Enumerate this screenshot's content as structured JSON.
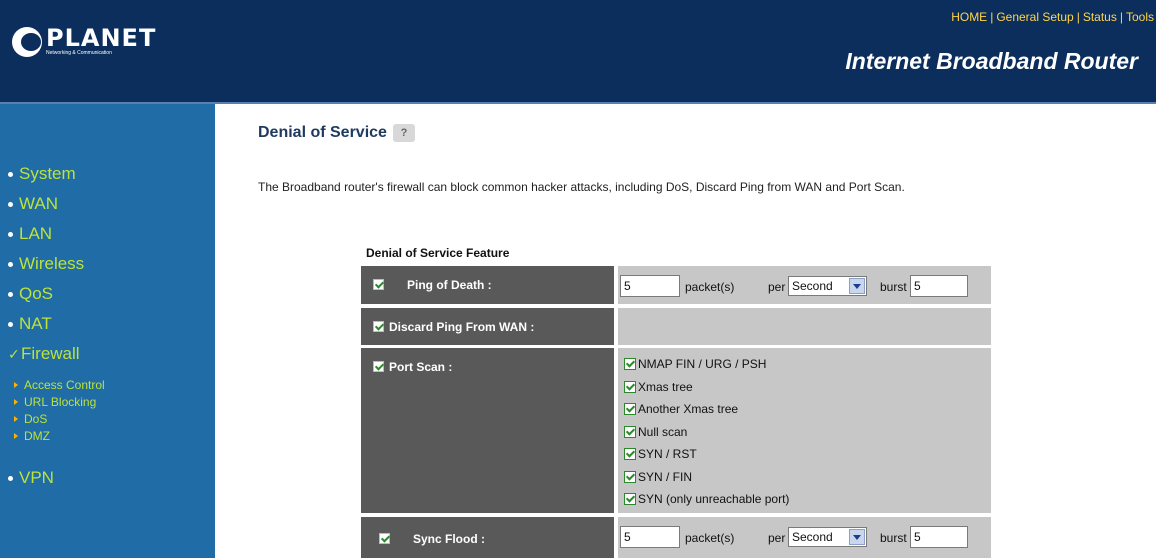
{
  "header": {
    "brand": "PLANET",
    "brand_sub": "Networking & Communication",
    "nav": [
      "HOME",
      "General Setup",
      "Status",
      "Tools"
    ],
    "nav_separator": "|",
    "product_title": "Internet Broadband Router"
  },
  "sidebar": {
    "items": [
      {
        "label": "System"
      },
      {
        "label": "WAN"
      },
      {
        "label": "LAN"
      },
      {
        "label": "Wireless"
      },
      {
        "label": "QoS"
      },
      {
        "label": "NAT"
      },
      {
        "label": "Firewall",
        "selected": true
      },
      {
        "label": "VPN"
      }
    ],
    "firewall_sub": [
      {
        "label": "Access Control"
      },
      {
        "label": "URL Blocking"
      },
      {
        "label": "DoS"
      },
      {
        "label": "DMZ"
      }
    ]
  },
  "main": {
    "title": "Denial of Service",
    "description": "The Broadband router's firewall can block common hacker attacks, including DoS, Discard Ping from WAN and Port Scan.",
    "section_title": "Denial of Service Feature",
    "ping_of_death": {
      "label": "Ping of Death :",
      "checked": true,
      "packets": "5",
      "packets_unit": "packet(s)",
      "per": "per",
      "period": "Second",
      "burst_label": "burst",
      "burst": "5"
    },
    "discard_ping": {
      "label": "Discard Ping From WAN :",
      "checked": true
    },
    "port_scan": {
      "label": "Port Scan :",
      "checked": true,
      "options": [
        {
          "label": "NMAP FIN / URG / PSH",
          "checked": true
        },
        {
          "label": "Xmas tree",
          "checked": true
        },
        {
          "label": "Another Xmas tree",
          "checked": true
        },
        {
          "label": "Null scan",
          "checked": true
        },
        {
          "label": "SYN / RST",
          "checked": true
        },
        {
          "label": "SYN / FIN",
          "checked": true
        },
        {
          "label": "SYN (only unreachable port)",
          "checked": true
        }
      ]
    },
    "sync_flood": {
      "label": "Sync Flood :",
      "checked": true,
      "packets": "5",
      "packets_unit": "packet(s)",
      "per": "per",
      "period": "Second",
      "burst_label": "burst",
      "burst": "5"
    }
  },
  "colors": {
    "header_bg": "#0b2e5c",
    "sidebar_bg": "#1f6ca6",
    "menu_text": "#bde33a",
    "nav_text": "#ffd54a",
    "label_cell": "#595959",
    "value_cell": "#c7c7c7"
  }
}
